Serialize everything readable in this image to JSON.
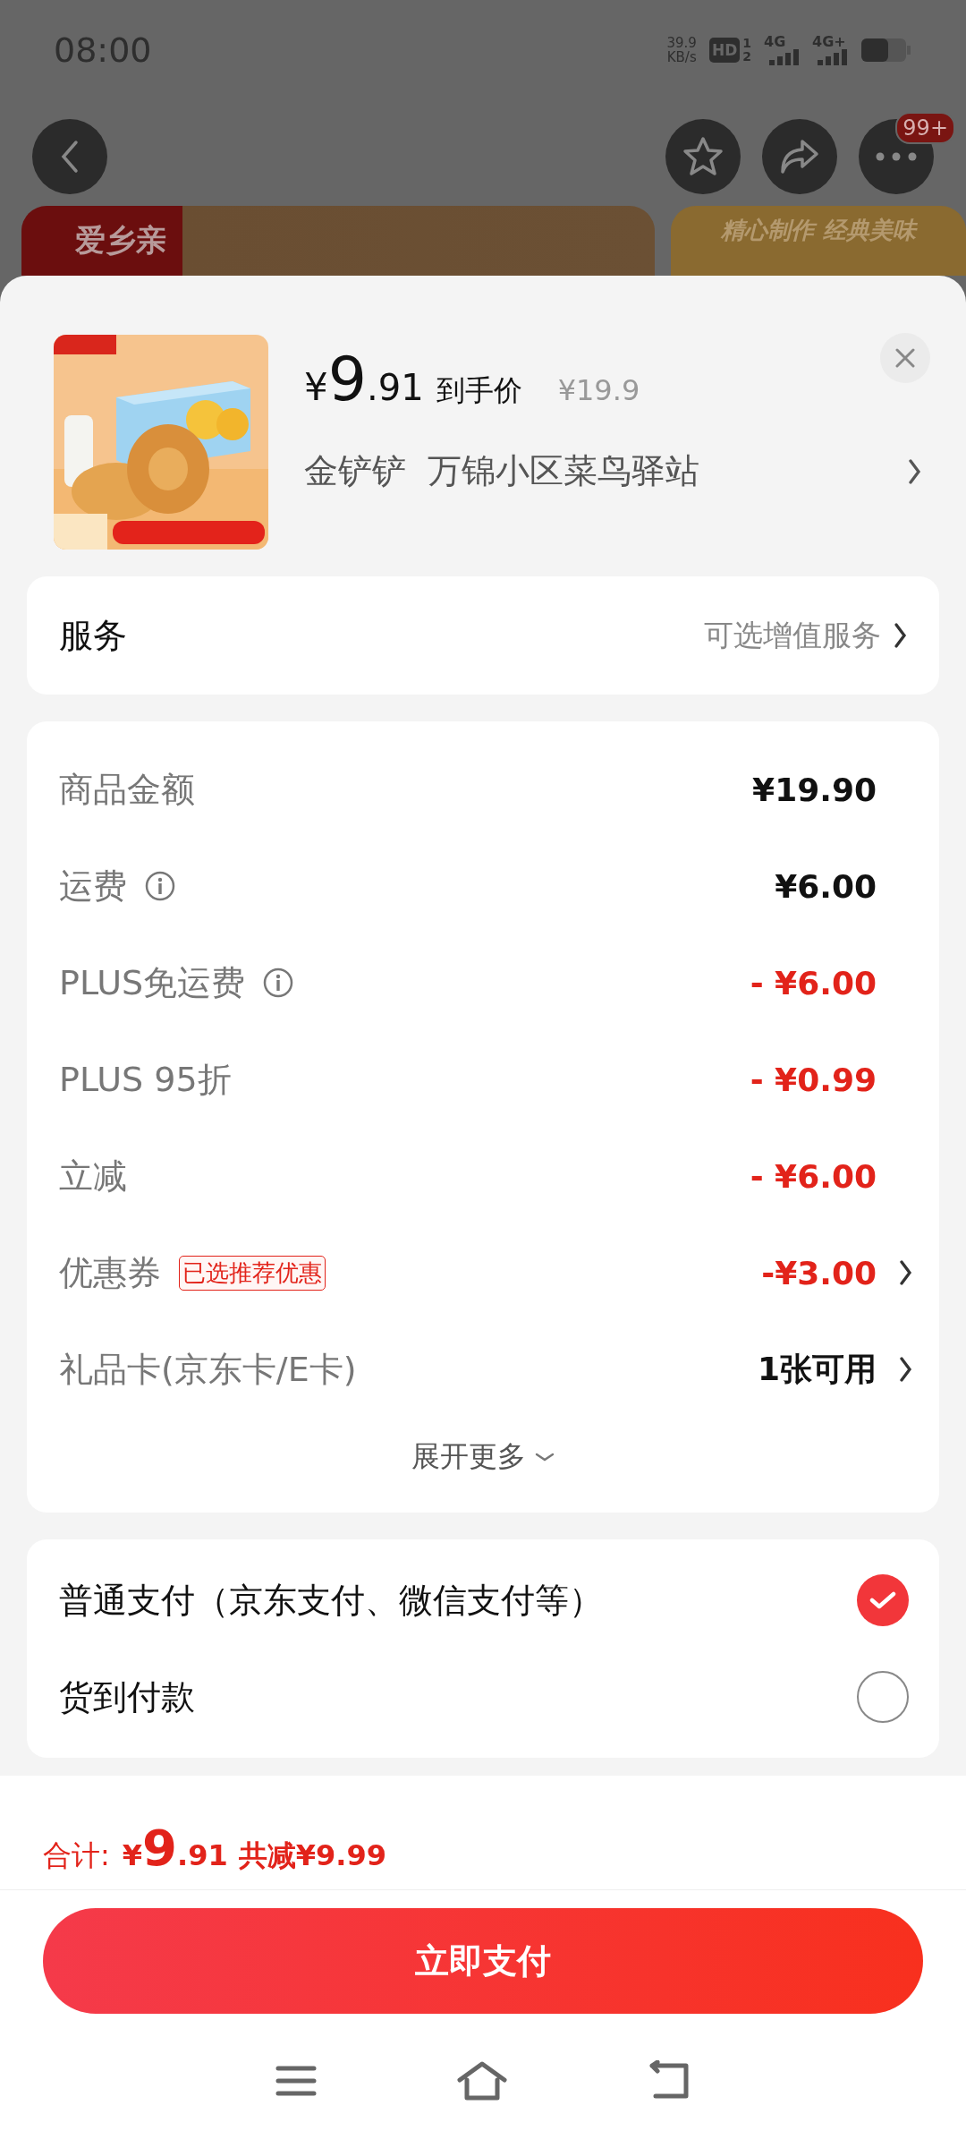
{
  "status_bar": {
    "time": "08:00",
    "speed": "39.9",
    "speed_unit": "KB/s",
    "hd": "HD",
    "sim_1": "1",
    "sim_2": "2",
    "network_1": "4G",
    "network_2": "4G+"
  },
  "header": {
    "more_badge": "99+"
  },
  "background": {
    "brand": "爱乡亲",
    "slogan": "精心制作 经典美味"
  },
  "product": {
    "kind": "picture",
    "price_symbol": "¥",
    "price_int": "9",
    "price_dec": ".91",
    "price_label": "到手价",
    "original_price": "¥19.9",
    "receiver": "金铲铲",
    "address": "万锦小区菜鸟驿站"
  },
  "service": {
    "label": "服务",
    "value": "可选增值服务"
  },
  "costs": [
    {
      "label": "商品金额",
      "info": false,
      "value": "¥19.90",
      "kind": "amount",
      "arrow": false
    },
    {
      "label": "运费",
      "info": true,
      "value": "¥6.00",
      "kind": "amount",
      "arrow": false
    },
    {
      "label": "PLUS免运费",
      "info": true,
      "value": "- ¥6.00",
      "kind": "discount",
      "arrow": false
    },
    {
      "label": "PLUS 95折",
      "info": false,
      "value": "- ¥0.99",
      "kind": "discount",
      "arrow": false
    },
    {
      "label": "立减",
      "info": false,
      "value": "- ¥6.00",
      "kind": "discount",
      "arrow": false
    },
    {
      "label": "优惠券",
      "info": false,
      "tag": "已选推荐优惠",
      "value": "-¥3.00",
      "kind": "discount",
      "arrow": true
    },
    {
      "label": "礼品卡(京东卡/E卡)",
      "info": false,
      "value": "1张可用",
      "kind": "amount",
      "arrow": true
    }
  ],
  "expand": "展开更多",
  "payment_options": [
    {
      "label": "普通支付（京东支付、微信支付等）",
      "selected": true
    },
    {
      "label": "货到付款",
      "selected": false
    }
  ],
  "total": {
    "label": "合计:",
    "symbol": "¥",
    "int": "9",
    "dec": ".91",
    "saving": "共减¥9.99"
  },
  "pay_button": "立即支付"
}
